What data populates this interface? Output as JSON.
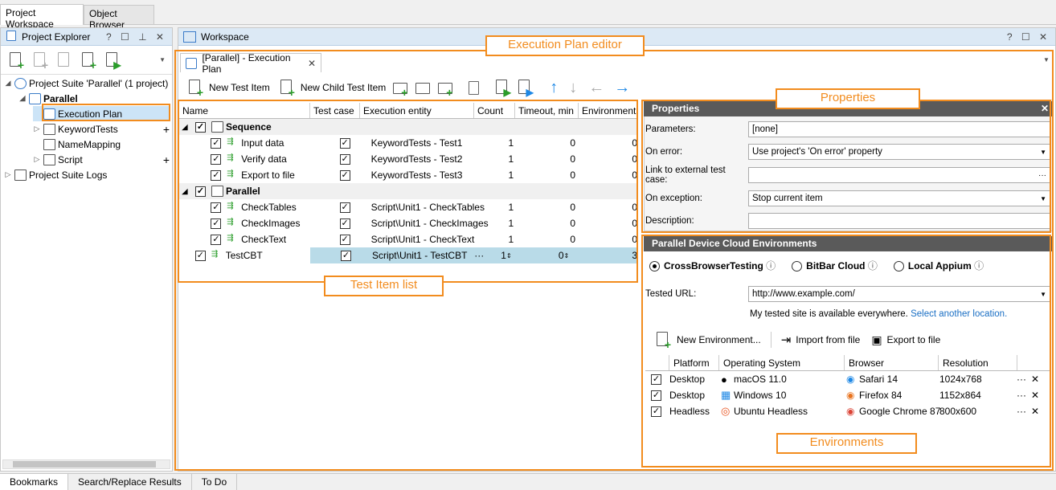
{
  "top_tabs": [
    "Project Workspace",
    "Object Browser"
  ],
  "explorer": {
    "title": "Project Explorer",
    "controls": "? ☐ ⊥ ✕",
    "tree": [
      {
        "label": "Project Suite 'Parallel' (1 project)",
        "level": 0
      },
      {
        "label": "Parallel",
        "level": 1
      },
      {
        "label": "Execution Plan",
        "level": 2
      },
      {
        "label": "KeywordTests",
        "level": 2
      },
      {
        "label": "NameMapping",
        "level": 2
      },
      {
        "label": "Script",
        "level": 2
      },
      {
        "label": "Project Suite Logs",
        "level": 0
      }
    ]
  },
  "workspace": {
    "title": "Workspace",
    "controls": "? ☐ ✕",
    "doc_tab": "[Parallel] - Execution Plan",
    "toolbar": {
      "new_test_item": "New Test Item",
      "new_child_test_item": "New Child Test Item"
    },
    "grid": {
      "columns": [
        "Name",
        "Test case",
        "Execution entity",
        "Count",
        "Timeout, min",
        "Environments"
      ],
      "rows": [
        {
          "type": "group",
          "name": "Sequence"
        },
        {
          "type": "item",
          "name": "Input data",
          "entity": "KeywordTests - Test1",
          "count": "1",
          "timeout": "0",
          "env": "0"
        },
        {
          "type": "item",
          "name": "Verify data",
          "entity": "KeywordTests - Test2",
          "count": "1",
          "timeout": "0",
          "env": "0"
        },
        {
          "type": "item",
          "name": "Export to file",
          "entity": "KeywordTests - Test3",
          "count": "1",
          "timeout": "0",
          "env": "0"
        },
        {
          "type": "group",
          "name": "Parallel"
        },
        {
          "type": "item",
          "name": "CheckTables",
          "entity": "Script\\Unit1 - CheckTables",
          "count": "1",
          "timeout": "0",
          "env": "0"
        },
        {
          "type": "item",
          "name": "CheckImages",
          "entity": "Script\\Unit1 - CheckImages",
          "count": "1",
          "timeout": "0",
          "env": "0"
        },
        {
          "type": "item",
          "name": "CheckText",
          "entity": "Script\\Unit1 - CheckText",
          "count": "1",
          "timeout": "0",
          "env": "0"
        },
        {
          "type": "selected",
          "name": "TestCBT",
          "entity": "Script\\Unit1 - TestCBT",
          "count": "1",
          "timeout": "0",
          "env": "3"
        }
      ]
    }
  },
  "properties": {
    "title": "Properties",
    "parameters_label": "Parameters:",
    "parameters_value": "[none]",
    "on_error_label": "On error:",
    "on_error_value": "Use project's 'On error' property",
    "link_label": "Link to external test case:",
    "link_value": "",
    "on_exception_label": "On exception:",
    "on_exception_value": "Stop current item",
    "description_label": "Description:",
    "description_value": ""
  },
  "cloud": {
    "title": "Parallel Device Cloud Environments",
    "providers": [
      "CrossBrowserTesting",
      "BitBar Cloud",
      "Local Appium"
    ],
    "tested_url_label": "Tested URL:",
    "tested_url_value": "http://www.example.com/",
    "availability": "My tested site is available everywhere.",
    "select_location": "Select another location.",
    "new_env": "New Environment...",
    "import": "Import from file",
    "export": "Export to file",
    "env_columns": [
      "Platform",
      "Operating System",
      "Browser",
      "Resolution"
    ],
    "envs": [
      {
        "platform": "Desktop",
        "os": "macOS 11.0",
        "browser": "Safari 14",
        "resolution": "1024x768"
      },
      {
        "platform": "Desktop",
        "os": "Windows 10",
        "browser": "Firefox 84",
        "resolution": "1152x864"
      },
      {
        "platform": "Headless",
        "os": "Ubuntu Headless",
        "browser": "Google Chrome 87",
        "resolution": "800x600"
      }
    ]
  },
  "callouts": {
    "editor": "Execution Plan editor",
    "properties": "Properties",
    "test_items": "Test Item list",
    "environments": "Environments"
  },
  "bottom_tabs": [
    "Bookmarks",
    "Search/Replace Results",
    "To Do"
  ]
}
